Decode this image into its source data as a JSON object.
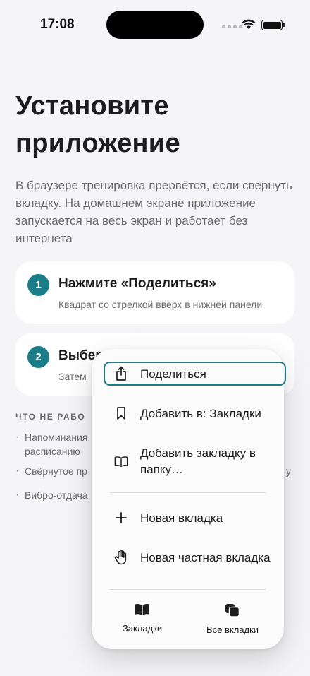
{
  "status_bar": {
    "time": "17:08"
  },
  "main": {
    "title_line1": "Установите",
    "title_line2": "приложение",
    "description": "В браузере тренировка прервётся, если свернуть вкладку. На домашнем экране приложение запускается на весь экран и работает без интернета",
    "steps": [
      {
        "number": "1",
        "title": "Нажмите «Поделиться»",
        "subtitle": "Квадрат со стрелкой вверх в нижней панели"
      },
      {
        "number": "2",
        "title": "Выбер",
        "subtitle": "Затем"
      }
    ],
    "not_work_heading": "ЧТО НЕ РАБО",
    "not_work_items": [
      {
        "line1": "Напоминания",
        "line2": "расписанию"
      },
      {
        "line1": "Свёрнутое пр",
        "tail": "у"
      },
      {
        "line1": "Вибро-отдача"
      }
    ]
  },
  "share_menu": {
    "items": [
      {
        "label": "Поделиться",
        "icon": "share-icon"
      },
      {
        "label": "Добавить в: Закладки",
        "icon": "bookmark-icon"
      },
      {
        "label": "Добавить закладку в папку…",
        "icon": "book-icon"
      },
      {
        "label": "Новая вкладка",
        "icon": "plus-icon"
      },
      {
        "label": "Новая частная вкладка",
        "icon": "hand-icon"
      }
    ],
    "bottom": [
      {
        "label": "Закладки",
        "icon": "bookmarks-book-icon"
      },
      {
        "label": "Все вкладки",
        "icon": "tabs-icon"
      }
    ]
  },
  "colors": {
    "accent": "#1b7d87",
    "background": "#f5f5f7",
    "text": "#1d1d1f",
    "muted": "#6b6b70"
  }
}
